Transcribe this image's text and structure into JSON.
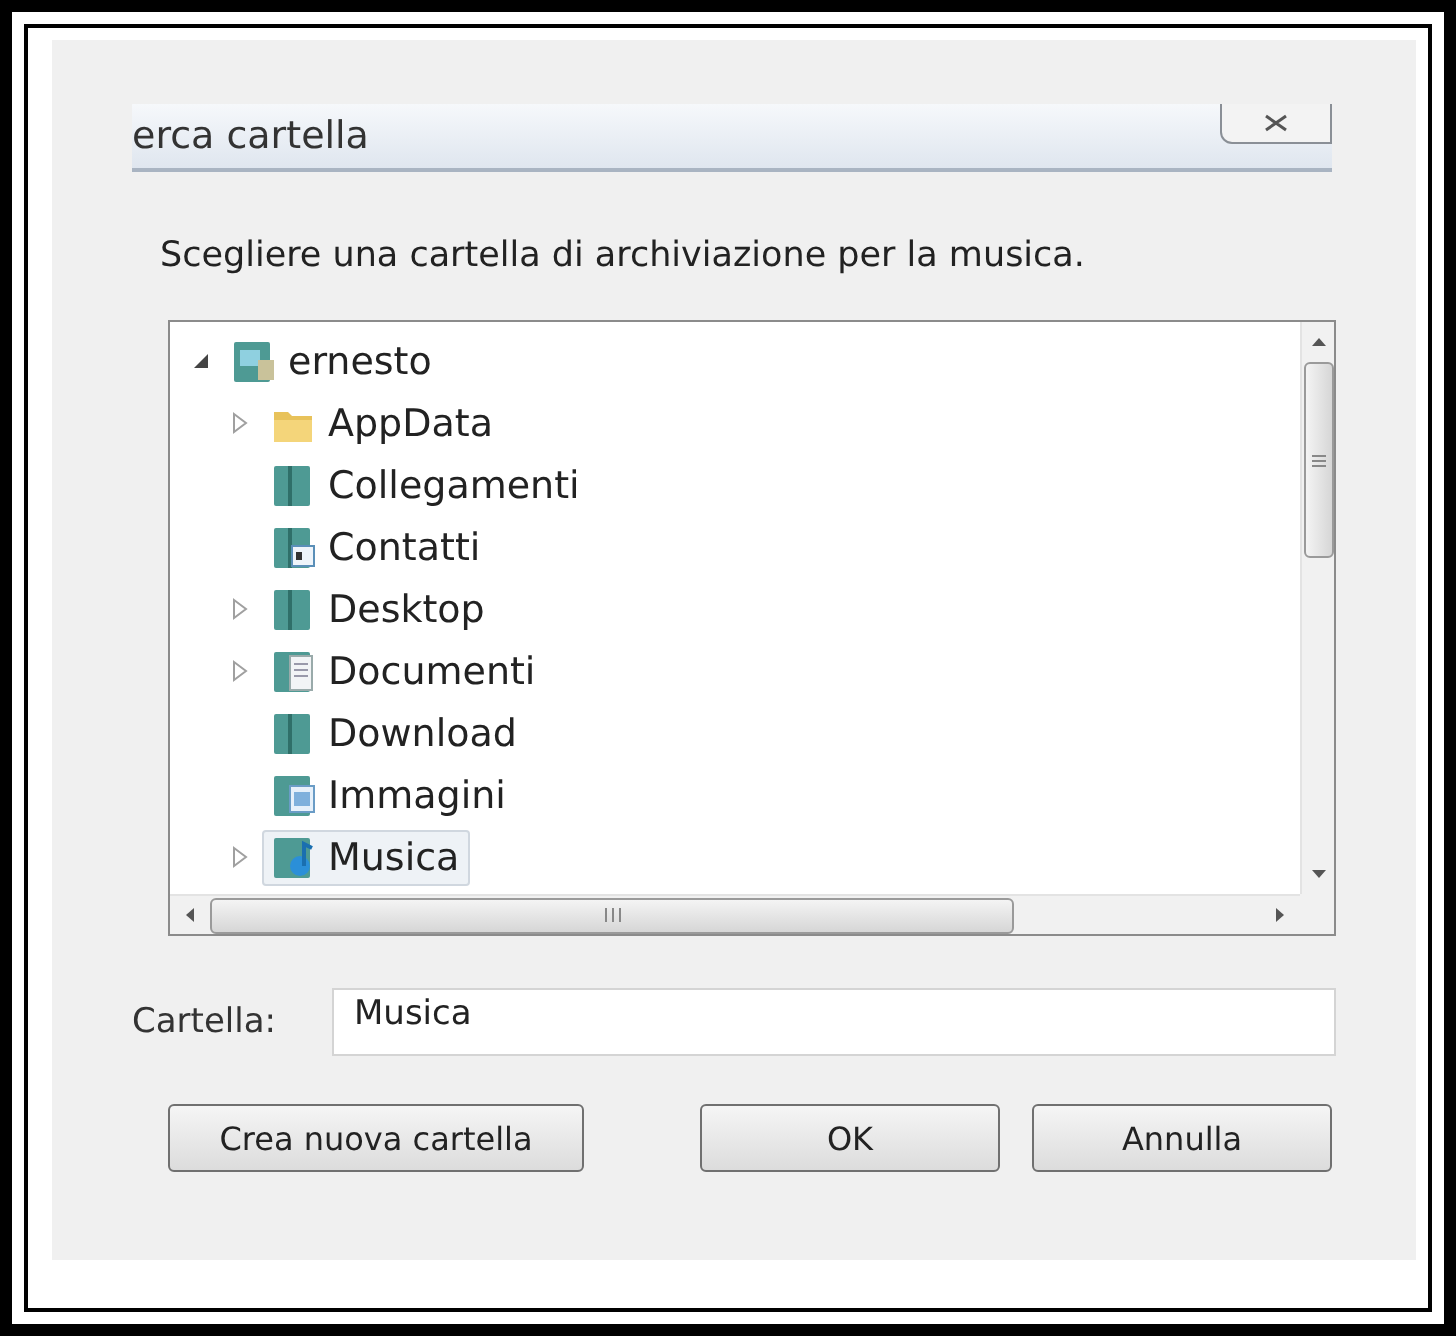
{
  "window": {
    "title": "erca cartella"
  },
  "instruction": "Scegliere una cartella di archiviazione per la musica.",
  "tree": {
    "items": [
      {
        "label": "ernesto",
        "kind": "user",
        "expanded": true,
        "selected": false,
        "children": [
          {
            "label": "AppData",
            "kind": "folder",
            "expanded": false,
            "selected": false
          },
          {
            "label": "Collegamenti",
            "kind": "library",
            "selected": false
          },
          {
            "label": "Contatti",
            "kind": "contacts",
            "selected": false
          },
          {
            "label": "Desktop",
            "kind": "library",
            "expanded": false,
            "selected": false
          },
          {
            "label": "Documenti",
            "kind": "documents",
            "expanded": false,
            "selected": false
          },
          {
            "label": "Download",
            "kind": "library",
            "selected": false
          },
          {
            "label": "Immagini",
            "kind": "pictures",
            "selected": false
          },
          {
            "label": "Musica",
            "kind": "music",
            "expanded": false,
            "selected": true
          }
        ]
      }
    ]
  },
  "folder_field": {
    "label": "Cartella:",
    "value": "Musica"
  },
  "buttons": [
    {
      "label": "Crea nuova cartella",
      "kind": "secondary"
    },
    {
      "label": "OK",
      "kind": "primary"
    },
    {
      "label": "Annulla",
      "kind": "primary"
    }
  ]
}
